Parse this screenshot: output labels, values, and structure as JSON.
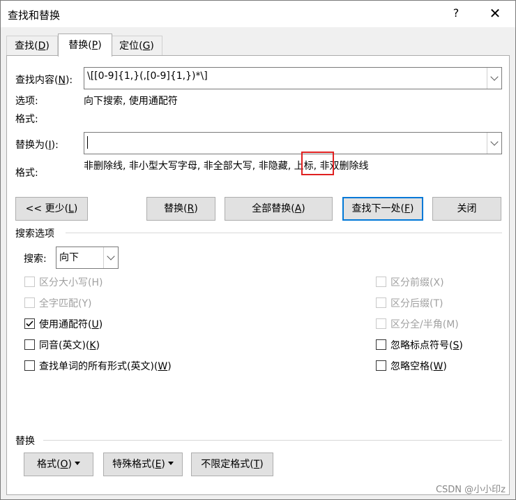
{
  "window": {
    "title": "查找和替换",
    "help": "?",
    "close": "✕"
  },
  "tabs": [
    {
      "text": "查找(",
      "key": "D",
      "end": ")"
    },
    {
      "text": "替换(",
      "key": "P",
      "end": ")"
    },
    {
      "text": "定位(",
      "key": "G",
      "end": ")"
    }
  ],
  "find": {
    "label": "查找内容(",
    "key": "N",
    "end": "):",
    "value": "\\[[0-9]{1,}(,[0-9]{1,})*\\]"
  },
  "options": {
    "label": "选项:",
    "value": "向下搜索, 使用通配符"
  },
  "format1": {
    "label": "格式:"
  },
  "replace": {
    "label": "替换为(",
    "key": "I",
    "end": "):",
    "value": ""
  },
  "format2": {
    "label": "格式:",
    "value": "非删除线, 非小型大写字母, 非全部大写, 非隐藏, 上标, 非双删除线"
  },
  "buttons": {
    "less": {
      "text": "<< 更少(",
      "key": "L",
      "end": ")"
    },
    "replace": {
      "text": "替换(",
      "key": "R",
      "end": ")"
    },
    "replace_all": {
      "text": "全部替换(",
      "key": "A",
      "end": ")"
    },
    "find_next": {
      "text": "查找下一处(",
      "key": "F",
      "end": ")"
    },
    "close": "关闭"
  },
  "search_options": {
    "title": "搜索选项",
    "search_label": "搜索:",
    "search_value": "向下",
    "left": [
      {
        "text": "区分大小写(",
        "key": "H",
        "end": ")",
        "checked": false,
        "disabled": true
      },
      {
        "text": "全字匹配(",
        "key": "Y",
        "end": ")",
        "checked": false,
        "disabled": true
      },
      {
        "text": "使用通配符(",
        "key": "U",
        "end": ")",
        "checked": true,
        "disabled": false
      },
      {
        "text": "同音(英文)(",
        "key": "K",
        "end": ")",
        "checked": false,
        "disabled": false
      },
      {
        "text": "查找单词的所有形式(英文)(",
        "key": "W",
        "end": ")",
        "checked": false,
        "disabled": false
      }
    ],
    "right": [
      {
        "text": "区分前缀(",
        "key": "X",
        "end": ")",
        "checked": false,
        "disabled": true
      },
      {
        "text": "区分后缀(",
        "key": "T",
        "end": ")",
        "checked": false,
        "disabled": true
      },
      {
        "text": "区分全/半角(",
        "key": "M",
        "end": ")",
        "checked": false,
        "disabled": true
      },
      {
        "text": "忽略标点符号(",
        "key": "S",
        "end": ")",
        "checked": false,
        "disabled": false
      },
      {
        "text": "忽略空格(",
        "key": "W",
        "end": ")",
        "checked": false,
        "disabled": false
      }
    ]
  },
  "replace_section": {
    "title": "替换",
    "format_btn": {
      "text": "格式(",
      "key": "O",
      "end": ")"
    },
    "special_btn": {
      "text": "特殊格式(",
      "key": "E",
      "end": ")"
    },
    "noformat_btn": {
      "text": "不限定格式(",
      "key": "T",
      "end": ")"
    }
  },
  "watermark": "CSDN @小小印z",
  "colors": {
    "accent": "#0078d7",
    "highlight": "#e02020"
  }
}
